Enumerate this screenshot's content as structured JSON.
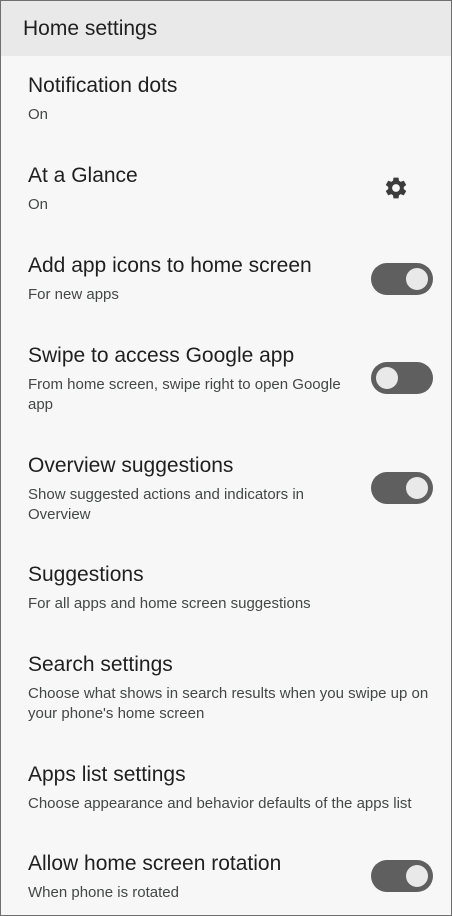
{
  "header": {
    "title": "Home settings"
  },
  "settings": [
    {
      "title": "Notification dots",
      "subtitle": "On"
    },
    {
      "title": "At a Glance",
      "subtitle": "On",
      "icon": "gear-icon"
    },
    {
      "title": "Add app icons to home screen",
      "subtitle": "For new apps",
      "toggle": true
    },
    {
      "title": "Swipe to access Google app",
      "subtitle": "From home screen, swipe right to open Google app",
      "toggle": false
    },
    {
      "title": "Overview suggestions",
      "subtitle": "Show suggested actions and indicators in Overview",
      "toggle": true
    },
    {
      "title": "Suggestions",
      "subtitle": "For all apps and home screen suggestions"
    },
    {
      "title": "Search settings",
      "subtitle": "Choose what shows in search results when you swipe up on your phone's home screen"
    },
    {
      "title": "Apps list settings",
      "subtitle": "Choose appearance and behavior defaults of the apps list"
    },
    {
      "title": "Allow home screen rotation",
      "subtitle": "When phone is rotated",
      "toggle": true
    }
  ],
  "colors": {
    "header_bg": "#e9e9e9",
    "page_bg": "#f7f7f7",
    "toggle_track": "#5f5f5f",
    "toggle_knob": "#e9e9e9"
  }
}
